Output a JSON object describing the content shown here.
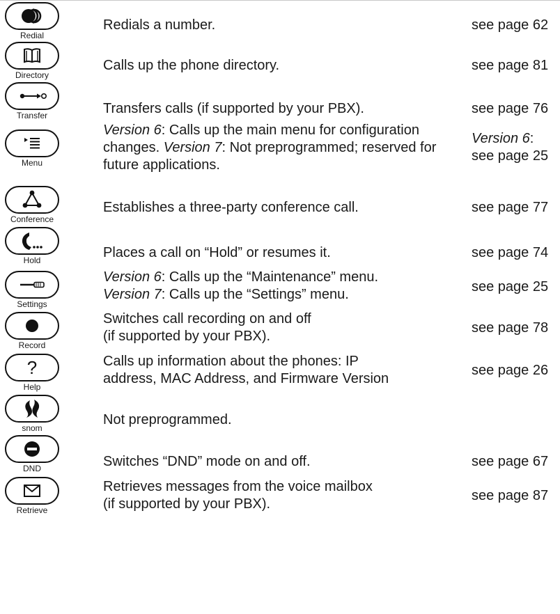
{
  "rows": [
    {
      "key_label": "Redial",
      "icon": "redial-icon",
      "desc": "Redials a number.",
      "page": "see page 62"
    },
    {
      "key_label": "Directory",
      "icon": "book-icon",
      "desc": "Calls up the phone directory.",
      "page": "see page 81"
    },
    {
      "key_label": "Transfer",
      "icon": "transfer-icon",
      "desc": "Transfers calls (if supported by your PBX).",
      "page": "see page 76"
    },
    {
      "key_label": "Menu",
      "icon": "menu-list-icon",
      "desc_v6_tag": "Version 6",
      "desc_v6_text": ": Calls up the main menu for configuration changes. ",
      "desc_v7_tag": "Version 7",
      "desc_v7_text": ": Not preprogrammed; reserved for future applications.",
      "page_tag": "Version 6",
      "page_tag_suffix": ":",
      "page": "see page 25"
    },
    {
      "key_label": "Conference",
      "icon": "conference-triangle-icon",
      "desc": "Establishes a three-party conference call.",
      "page": "see page 77"
    },
    {
      "key_label": "Hold",
      "icon": "phone-handset-icon",
      "desc": "Places a call on “Hold” or resumes it.",
      "page": "see page 74"
    },
    {
      "key_label": "Settings",
      "icon": "settings-slider-icon",
      "desc_v6_tag": "Version 6",
      "desc_v6_text": ": Calls up the “Maintenance” menu.",
      "desc_v7_tag": "Version 7",
      "desc_v7_text": ": Calls up the “Settings” menu.",
      "page": "see page 25"
    },
    {
      "key_label": "Record",
      "icon": "record-dot-icon",
      "desc_line1": "Switches call recording on and off",
      "desc_line2": "(if supported by your PBX).",
      "page": "see page 78"
    },
    {
      "key_label": "Help",
      "icon": "question-mark-icon",
      "desc_line1": "Calls up information about the phones: IP",
      "desc_line2": "address, MAC Address, and Firmware Version",
      "page": "see page 26"
    },
    {
      "key_label": "snom",
      "icon": "snom-logo-icon",
      "desc": "Not preprogrammed.",
      "page": ""
    },
    {
      "key_label": "DND",
      "icon": "dnd-icon",
      "desc": "Switches “DND” mode on and off.",
      "page": "see page 67"
    },
    {
      "key_label": "Retrieve",
      "icon": "envelope-icon",
      "desc_line1": "Retrieves messages from the voice mailbox",
      "desc_line2": "(if supported by your PBX).",
      "page": "see page 87"
    }
  ]
}
